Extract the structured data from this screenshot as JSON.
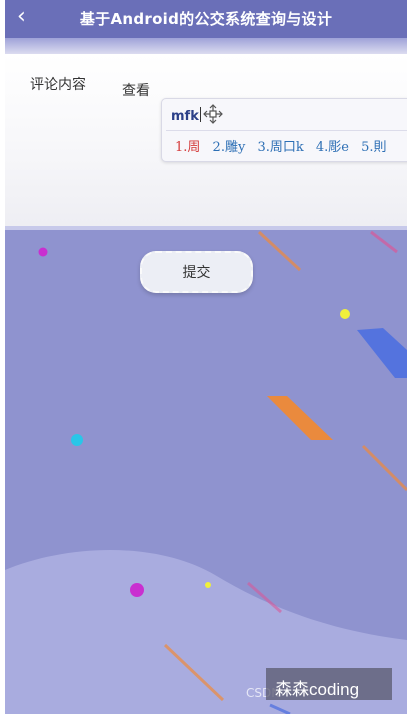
{
  "header": {
    "title": "基于Android的公交系统查询与设计",
    "back_icon": "chevron-left-icon"
  },
  "form": {
    "comment_label": "评论内容",
    "view_label": "查看",
    "submit_label": "提交"
  },
  "ime": {
    "input_text": "mfk",
    "move_icon": "move-icon",
    "candidates": [
      "1.周",
      "2.雕y",
      "3.周口k",
      "4.彫e",
      "5.則"
    ]
  },
  "watermark": {
    "text": "森森coding",
    "csdn": "CSDN"
  },
  "colors": {
    "header_bg": "#6a6fb8",
    "content_bg": "#8f93cf",
    "candidate_first": "#d43a3a",
    "candidate": "#2d6fb5"
  }
}
